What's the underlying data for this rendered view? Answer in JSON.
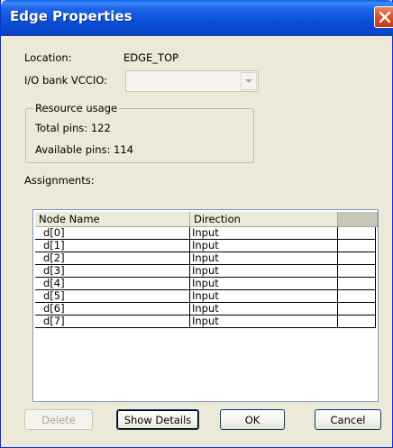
{
  "window": {
    "title": "Edge Properties"
  },
  "location": {
    "label": "Location:",
    "value": "EDGE_TOP"
  },
  "io_bank": {
    "label": "I/O bank VCCIO:",
    "value": ""
  },
  "resource": {
    "title": "Resource usage",
    "total": "Total pins: 122",
    "available": "Available pins: 114"
  },
  "assignments": {
    "label": "Assignments:",
    "columns": [
      "Node Name",
      "Direction"
    ],
    "rows": [
      {
        "node": "d[0]",
        "direction": "Input"
      },
      {
        "node": "d[1]",
        "direction": "Input"
      },
      {
        "node": "d[2]",
        "direction": "Input"
      },
      {
        "node": "d[3]",
        "direction": "Input"
      },
      {
        "node": "d[4]",
        "direction": "Input"
      },
      {
        "node": "d[5]",
        "direction": "Input"
      },
      {
        "node": "d[6]",
        "direction": "Input"
      },
      {
        "node": "d[7]",
        "direction": "Input"
      }
    ]
  },
  "buttons": {
    "delete": "Delete",
    "show_details": "Show Details",
    "ok": "OK",
    "cancel": "Cancel"
  },
  "icons": {
    "close": "close-icon",
    "dropdown": "chevron-down-icon"
  }
}
